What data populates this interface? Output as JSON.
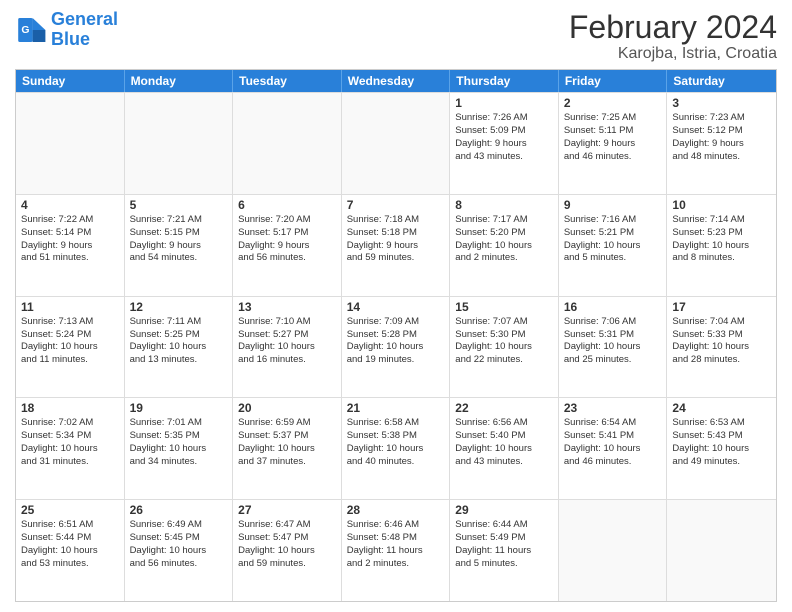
{
  "logo": {
    "line1": "General",
    "line2": "Blue"
  },
  "title": {
    "main": "February 2024",
    "sub": "Karojba, Istria, Croatia"
  },
  "days": [
    "Sunday",
    "Monday",
    "Tuesday",
    "Wednesday",
    "Thursday",
    "Friday",
    "Saturday"
  ],
  "weeks": [
    [
      {
        "day": "",
        "text": ""
      },
      {
        "day": "",
        "text": ""
      },
      {
        "day": "",
        "text": ""
      },
      {
        "day": "",
        "text": ""
      },
      {
        "day": "1",
        "text": "Sunrise: 7:26 AM\nSunset: 5:09 PM\nDaylight: 9 hours\nand 43 minutes."
      },
      {
        "day": "2",
        "text": "Sunrise: 7:25 AM\nSunset: 5:11 PM\nDaylight: 9 hours\nand 46 minutes."
      },
      {
        "day": "3",
        "text": "Sunrise: 7:23 AM\nSunset: 5:12 PM\nDaylight: 9 hours\nand 48 minutes."
      }
    ],
    [
      {
        "day": "4",
        "text": "Sunrise: 7:22 AM\nSunset: 5:14 PM\nDaylight: 9 hours\nand 51 minutes."
      },
      {
        "day": "5",
        "text": "Sunrise: 7:21 AM\nSunset: 5:15 PM\nDaylight: 9 hours\nand 54 minutes."
      },
      {
        "day": "6",
        "text": "Sunrise: 7:20 AM\nSunset: 5:17 PM\nDaylight: 9 hours\nand 56 minutes."
      },
      {
        "day": "7",
        "text": "Sunrise: 7:18 AM\nSunset: 5:18 PM\nDaylight: 9 hours\nand 59 minutes."
      },
      {
        "day": "8",
        "text": "Sunrise: 7:17 AM\nSunset: 5:20 PM\nDaylight: 10 hours\nand 2 minutes."
      },
      {
        "day": "9",
        "text": "Sunrise: 7:16 AM\nSunset: 5:21 PM\nDaylight: 10 hours\nand 5 minutes."
      },
      {
        "day": "10",
        "text": "Sunrise: 7:14 AM\nSunset: 5:23 PM\nDaylight: 10 hours\nand 8 minutes."
      }
    ],
    [
      {
        "day": "11",
        "text": "Sunrise: 7:13 AM\nSunset: 5:24 PM\nDaylight: 10 hours\nand 11 minutes."
      },
      {
        "day": "12",
        "text": "Sunrise: 7:11 AM\nSunset: 5:25 PM\nDaylight: 10 hours\nand 13 minutes."
      },
      {
        "day": "13",
        "text": "Sunrise: 7:10 AM\nSunset: 5:27 PM\nDaylight: 10 hours\nand 16 minutes."
      },
      {
        "day": "14",
        "text": "Sunrise: 7:09 AM\nSunset: 5:28 PM\nDaylight: 10 hours\nand 19 minutes."
      },
      {
        "day": "15",
        "text": "Sunrise: 7:07 AM\nSunset: 5:30 PM\nDaylight: 10 hours\nand 22 minutes."
      },
      {
        "day": "16",
        "text": "Sunrise: 7:06 AM\nSunset: 5:31 PM\nDaylight: 10 hours\nand 25 minutes."
      },
      {
        "day": "17",
        "text": "Sunrise: 7:04 AM\nSunset: 5:33 PM\nDaylight: 10 hours\nand 28 minutes."
      }
    ],
    [
      {
        "day": "18",
        "text": "Sunrise: 7:02 AM\nSunset: 5:34 PM\nDaylight: 10 hours\nand 31 minutes."
      },
      {
        "day": "19",
        "text": "Sunrise: 7:01 AM\nSunset: 5:35 PM\nDaylight: 10 hours\nand 34 minutes."
      },
      {
        "day": "20",
        "text": "Sunrise: 6:59 AM\nSunset: 5:37 PM\nDaylight: 10 hours\nand 37 minutes."
      },
      {
        "day": "21",
        "text": "Sunrise: 6:58 AM\nSunset: 5:38 PM\nDaylight: 10 hours\nand 40 minutes."
      },
      {
        "day": "22",
        "text": "Sunrise: 6:56 AM\nSunset: 5:40 PM\nDaylight: 10 hours\nand 43 minutes."
      },
      {
        "day": "23",
        "text": "Sunrise: 6:54 AM\nSunset: 5:41 PM\nDaylight: 10 hours\nand 46 minutes."
      },
      {
        "day": "24",
        "text": "Sunrise: 6:53 AM\nSunset: 5:43 PM\nDaylight: 10 hours\nand 49 minutes."
      }
    ],
    [
      {
        "day": "25",
        "text": "Sunrise: 6:51 AM\nSunset: 5:44 PM\nDaylight: 10 hours\nand 53 minutes."
      },
      {
        "day": "26",
        "text": "Sunrise: 6:49 AM\nSunset: 5:45 PM\nDaylight: 10 hours\nand 56 minutes."
      },
      {
        "day": "27",
        "text": "Sunrise: 6:47 AM\nSunset: 5:47 PM\nDaylight: 10 hours\nand 59 minutes."
      },
      {
        "day": "28",
        "text": "Sunrise: 6:46 AM\nSunset: 5:48 PM\nDaylight: 11 hours\nand 2 minutes."
      },
      {
        "day": "29",
        "text": "Sunrise: 6:44 AM\nSunset: 5:49 PM\nDaylight: 11 hours\nand 5 minutes."
      },
      {
        "day": "",
        "text": ""
      },
      {
        "day": "",
        "text": ""
      }
    ]
  ]
}
